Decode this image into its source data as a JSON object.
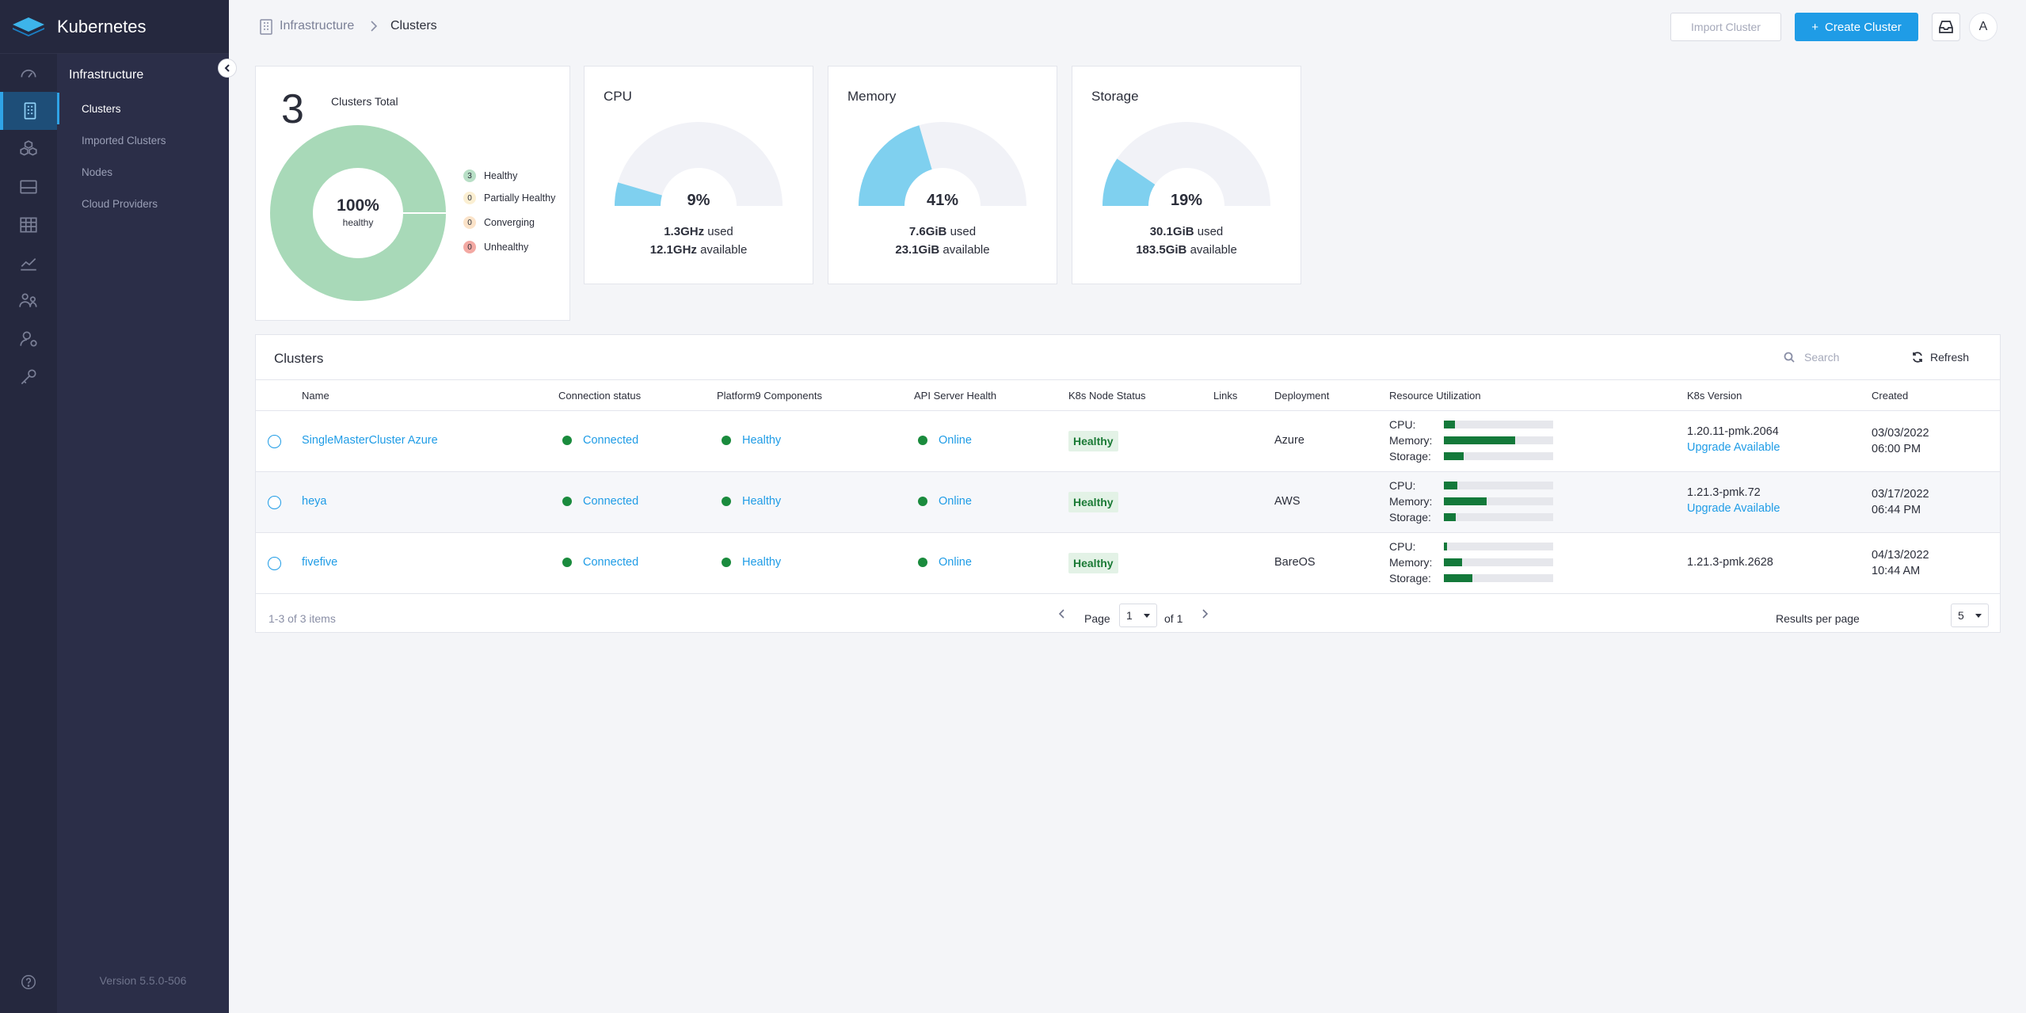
{
  "app": {
    "name": "Kubernetes",
    "version": "Version 5.5.0-506"
  },
  "rail": {
    "icons": [
      "dashboard-icon",
      "infrastructure-icon",
      "apps-icon",
      "storage-icon",
      "grid-icon",
      "monitoring-icon",
      "users-groups-icon",
      "user-settings-icon",
      "key-icon",
      "help-icon"
    ]
  },
  "subnav": {
    "title": "Infrastructure",
    "items": [
      {
        "label": "Clusters",
        "active": true
      },
      {
        "label": "Imported Clusters",
        "active": false
      },
      {
        "label": "Nodes",
        "active": false
      },
      {
        "label": "Cloud Providers",
        "active": false
      }
    ]
  },
  "breadcrumb": {
    "root": "Infrastructure",
    "current": "Clusters"
  },
  "header": {
    "import_label": "Import Cluster",
    "create_label": "Create Cluster",
    "avatar_letter": "A"
  },
  "colors": {
    "accent": "#1f9ce6",
    "healthy": "#a8d9b8",
    "gauge_fill": "#7fd0ef",
    "gauge_track": "#f1f2f7",
    "status_green": "#1a8b3d"
  },
  "summary": {
    "total": "3",
    "total_label": "Clusters Total",
    "donut_pct": "100%",
    "donut_sub": "healthy",
    "healthy_fraction": 1.0,
    "legend": [
      {
        "count": "3",
        "label": "Healthy",
        "color": "#b8dfc6"
      },
      {
        "count": "0",
        "label": "Partially Healthy",
        "color": "#fbefd2"
      },
      {
        "count": "0",
        "label": "Converging",
        "color": "#fbe3c9"
      },
      {
        "count": "0",
        "label": "Unhealthy",
        "color": "#f3a9a3"
      }
    ]
  },
  "gauges": [
    {
      "title": "CPU",
      "pct_label": "9%",
      "fraction": 0.09,
      "used": "1.3GHz",
      "used_suffix": " used",
      "available": "12.1GHz",
      "available_suffix": " available"
    },
    {
      "title": "Memory",
      "pct_label": "41%",
      "fraction": 0.41,
      "used": "7.6GiB",
      "used_suffix": " used",
      "available": "23.1GiB",
      "available_suffix": " available"
    },
    {
      "title": "Storage",
      "pct_label": "19%",
      "fraction": 0.19,
      "used": "30.1GiB",
      "used_suffix": " used",
      "available": "183.5GiB",
      "available_suffix": " available"
    }
  ],
  "table": {
    "title": "Clusters",
    "search_placeholder": "Search",
    "refresh_label": "Refresh",
    "columns": [
      "Name",
      "Connection status",
      "Platform9 Components",
      "API Server Health",
      "K8s Node Status",
      "Links",
      "Deployment",
      "Resource Utilization",
      "K8s Version",
      "Created"
    ],
    "util_labels": [
      "CPU:",
      "Memory:",
      "Storage:"
    ],
    "rows": [
      {
        "name": "SingleMasterCluster Azure",
        "connection": "Connected",
        "components": "Healthy",
        "api": "Online",
        "node_status": "Healthy",
        "deployment": "Azure",
        "cpu": 0.1,
        "memory": 0.65,
        "storage": 0.18,
        "version": "1.20.11-pmk.2064",
        "upgrade": "Upgrade Available",
        "created_date": "03/03/2022",
        "created_time": "06:00 PM"
      },
      {
        "name": "heya",
        "connection": "Connected",
        "components": "Healthy",
        "api": "Online",
        "node_status": "Healthy",
        "deployment": "AWS",
        "cpu": 0.12,
        "memory": 0.39,
        "storage": 0.11,
        "version": "1.21.3-pmk.72",
        "upgrade": "Upgrade Available",
        "created_date": "03/17/2022",
        "created_time": "06:44 PM"
      },
      {
        "name": "fivefive",
        "connection": "Connected",
        "components": "Healthy",
        "api": "Online",
        "node_status": "Healthy",
        "deployment": "BareOS",
        "cpu": 0.03,
        "memory": 0.17,
        "storage": 0.26,
        "version": "1.21.3-pmk.2628",
        "upgrade": "",
        "created_date": "04/13/2022",
        "created_time": "10:44 AM"
      }
    ],
    "pager": {
      "info": "1-3 of 3 items",
      "page_label": "Page",
      "page": "1",
      "of": "of 1",
      "rpp_label": "Results per page",
      "rpp": "5"
    }
  }
}
